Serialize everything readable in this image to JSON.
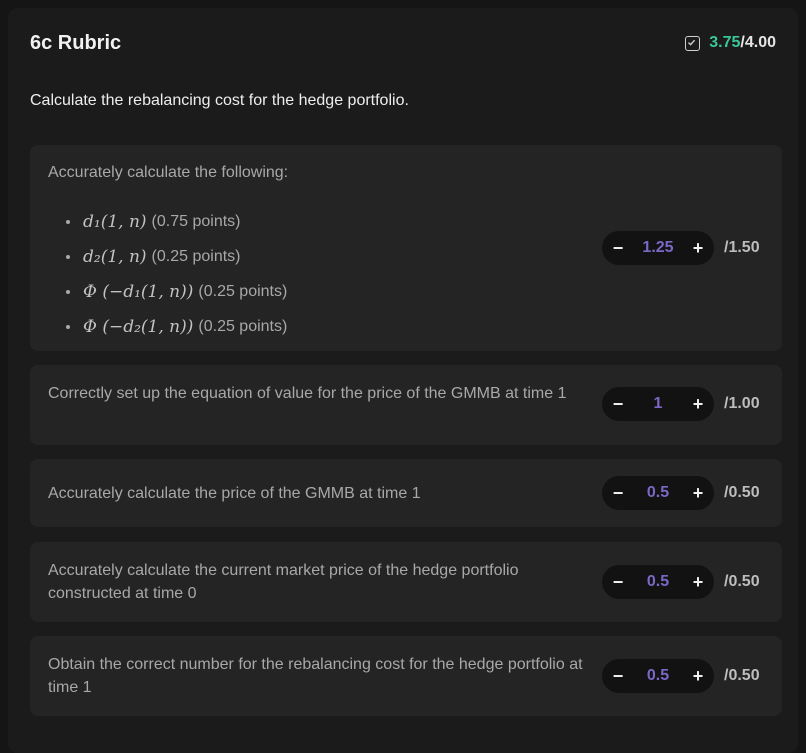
{
  "header": {
    "title": "6c Rubric",
    "score": "3.75",
    "total": "/4.00"
  },
  "question": "Calculate the rebalancing cost for the hedge portfolio.",
  "items": [
    {
      "text": "Accurately calculate the following:",
      "bullets": [
        {
          "math": "d₁(1, n)",
          "points": "(0.75 points)"
        },
        {
          "math": "d₂(1, n)",
          "points": "(0.25 points)"
        },
        {
          "math": "Φ (−d₁(1, n))",
          "points": "(0.25 points)"
        },
        {
          "math": "Φ (−d₂(1, n))",
          "points": "(0.25 points)"
        }
      ],
      "value": "1.25",
      "max": "/1.50"
    },
    {
      "text": "Correctly set up the equation of value for the price of the GMMB at time 1",
      "value": "1",
      "max": "/1.00"
    },
    {
      "text": "Accurately calculate the price of the GMMB at time 1",
      "value": "0.5",
      "max": "/0.50"
    },
    {
      "text": "Accurately calculate the current market price of the hedge portfolio constructed at time 0",
      "value": "0.5",
      "max": "/0.50"
    },
    {
      "text": "Obtain the correct number for the rebalancing cost for the hedge portfolio at time 1",
      "value": "0.5",
      "max": "/0.50"
    }
  ],
  "controls": {
    "minus": "−",
    "plus": "+"
  },
  "colors": {
    "score": "#39c79a",
    "value": "#7b68c6"
  }
}
